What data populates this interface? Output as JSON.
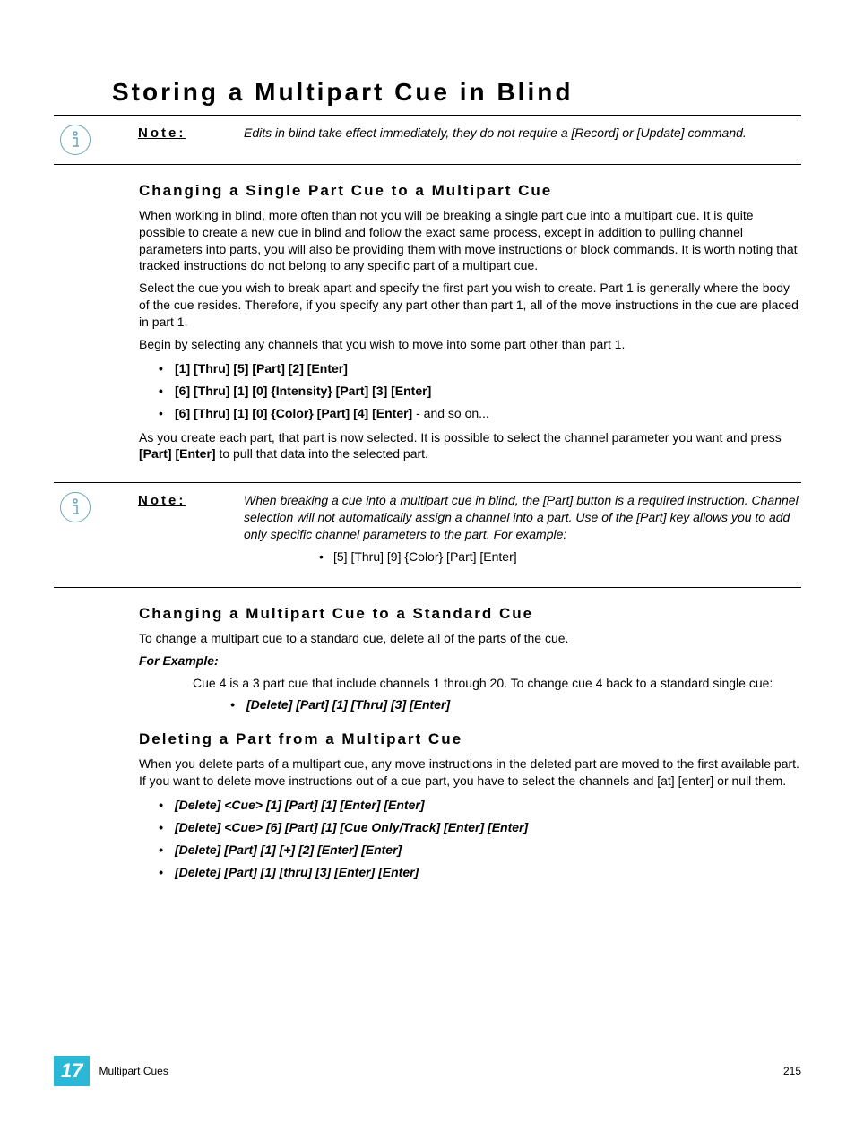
{
  "heading": "Storing a Multipart Cue in Blind",
  "note1": {
    "label": "Note:",
    "text": "Edits in blind take effect immediately, they do not require a [Record] or [Update] command."
  },
  "section1": {
    "title": "Changing a Single Part Cue to a Multipart Cue",
    "p1": "When working in blind, more often than not you will be breaking a single part cue into a multipart cue. It is quite possible to create a new cue in blind and follow the exact same process, except in addition to pulling channel parameters into parts, you will also be providing them with move instructions or block commands. It is worth noting that tracked instructions do not belong to any specific part of a multipart cue.",
    "p2": "Select the cue you wish to break apart and specify the first part you wish to create. Part 1 is generally where the body of the cue resides. Therefore, if you specify any part other than part 1, all of the move instructions in the cue are placed in part 1.",
    "p3": "Begin by selecting any channels that you wish to move into some part other than part 1.",
    "bullets": [
      "[1] [Thru] [5] [Part] [2] [Enter]",
      "[6] [Thru] [1] [0] {Intensity} [Part] [3] [Enter]",
      "[6] [Thru] [1] [0] {Color} [Part] [4] [Enter]"
    ],
    "bullet3_suffix": " - and so on...",
    "p4a": "As you create each part, that part is now selected. It is possible to select the channel parameter you want and press ",
    "p4b": "[Part] [Enter]",
    "p4c": " to pull that data into the selected part."
  },
  "note2": {
    "label": "Note:",
    "text": "When breaking a cue into a multipart cue in blind, the [Part] button is a required instruction. Channel selection will not automatically assign a channel into a part. Use of the [Part] key allows you to add only specific channel parameters to the part. For example:",
    "example": "[5] [Thru] [9] {Color} [Part] [Enter]"
  },
  "section2": {
    "title": "Changing a Multipart Cue to a Standard Cue",
    "p1": "To change a multipart cue to a standard cue, delete all of the parts of the cue.",
    "example_label": "For Example:",
    "example_text": "Cue 4 is a 3 part cue that include channels 1 through 20. To change cue 4 back to a standard single cue:",
    "example_bullet": "[Delete] [Part] [1] [Thru] [3] [Enter]"
  },
  "section3": {
    "title": "Deleting a Part from a Multipart Cue",
    "p1": "When you delete parts of a multipart cue, any move instructions in the deleted part are moved to the first available part. If you want to delete move instructions out of a cue part, you have to select the channels and [at] [enter] or null them.",
    "bullets": [
      "[Delete] <Cue> [1] [Part] [1] [Enter] [Enter]",
      "[Delete] <Cue> [6] [Part] [1] [Cue Only/Track] [Enter] [Enter]",
      "[Delete] [Part] [1] [+] [2] [Enter] [Enter]",
      "[Delete] [Part] [1] [thru] [3] [Enter] [Enter]"
    ]
  },
  "footer": {
    "chapter": "17",
    "section": "Multipart Cues",
    "page": "215"
  }
}
